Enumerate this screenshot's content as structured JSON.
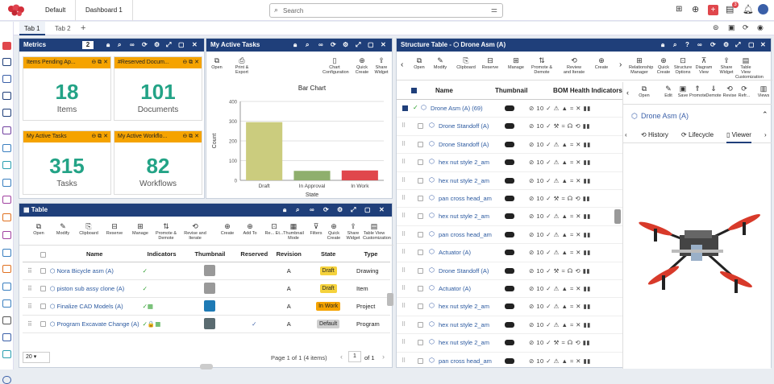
{
  "topbar": {
    "tab1": "Default",
    "tab2": "Dashboard 1",
    "search_placeholder": "Search",
    "notif_count": "3"
  },
  "tabbar": {
    "tab1": "Tab 1",
    "tab2": "Tab 2",
    "add": "+"
  },
  "metrics": {
    "title": "Metrics",
    "page": "2",
    "tiles": [
      {
        "header": "Items Pending Ap...",
        "value": "18",
        "label": "Items"
      },
      {
        "header": "#Reserved Docum...",
        "value": "101",
        "label": "Documents"
      },
      {
        "header": "My Active Tasks",
        "value": "315",
        "label": "Tasks"
      },
      {
        "header": "My Active Workflo...",
        "value": "82",
        "label": "Workflows"
      }
    ]
  },
  "tasks": {
    "title": "My Active Tasks",
    "toolbar": {
      "open": "Open",
      "print": "Print & Export",
      "chartcfg": "Chart Configuration",
      "quick": "Quick Create",
      "share": "Share Widget"
    }
  },
  "chart_data": {
    "type": "bar",
    "title": "Bar Chart",
    "xlabel": "State",
    "ylabel": "Count",
    "categories": [
      "Draft",
      "In Approval",
      "In Work"
    ],
    "values": [
      295,
      48,
      50
    ],
    "colors": [
      "#cbcc7e",
      "#8faf6d",
      "#e0474c"
    ],
    "ylim": [
      0,
      400
    ],
    "yticks": [
      "0",
      "100",
      "200",
      "300",
      "400"
    ],
    "grid": true
  },
  "table": {
    "title": "Table",
    "toolbar": [
      "Open",
      "Modify",
      "Clipboard",
      "Reserve",
      "Manage",
      "Promote & Demote",
      "Revise and Iterate",
      "Create",
      "Add To",
      "Re... Et...",
      "Thumbnail Mode",
      "Filters",
      "Quick Create",
      "Share Widget",
      "Table View Customization"
    ],
    "columns": [
      "Name",
      "Indicators",
      "Thumbnail",
      "Reserved",
      "Revision",
      "State",
      "Type"
    ],
    "rows": [
      {
        "name": "Nora Bicycle asm (A)",
        "indicator": "✓",
        "reserved": "",
        "revision": "A",
        "state": "Draft",
        "type": "Drawing"
      },
      {
        "name": "piston sub assy clone (A)",
        "indicator": "✓",
        "reserved": "",
        "revision": "A",
        "state": "Draft",
        "type": "Item"
      },
      {
        "name": "Finalize CAD Models (A)",
        "indicator": "✓▦",
        "reserved": "",
        "revision": "A",
        "state": "In Work",
        "type": "Project"
      },
      {
        "name": "Program Excavate Change (A)",
        "indicator": "✓🔒▦",
        "reserved": "✓",
        "revision": "A",
        "state": "Default",
        "type": "Program"
      }
    ],
    "page_size": "20",
    "pagination": "Page 1 of 1 (4 items)",
    "page_num": "1",
    "of": "of 1"
  },
  "structure": {
    "title": "Structure Table - ⬡ Drone Asm (A)",
    "toolbar": [
      "Open",
      "Modify",
      "Clipboard",
      "Reserve",
      "Manage",
      "Promote & Demote",
      "Review and Iterate",
      "Create",
      "Relationship Manager",
      "Quick Create",
      "Structure Options",
      "Diagram View",
      "Share Widget",
      "Table View Customization"
    ],
    "columns": [
      "Name",
      "Thumbnail",
      "BOM Health Indicators"
    ],
    "root": "Drone Asm (A) (69)",
    "rows": [
      "Drone Standoff (A)",
      "Drone Standoff (A)",
      "hex nut style 2_am",
      "hex nut style 2_am",
      "pan cross head_am",
      "hex nut style 2_am",
      "pan cross head_am",
      "Actuator (A)",
      "Drone Standoff (A)",
      "Actuator (A)",
      "hex nut style 2_am",
      "hex nut style 2_am",
      "hex nut style 2_am",
      "pan cross head_am"
    ],
    "health": "⊘ 10 ✓ ⚠ ▲ ≈ ✕ ▮▮",
    "health_alt": "⊘ 10 ✓ ⚒ ≈ ☊ ⟲ ▮▮"
  },
  "details": {
    "toolbar": [
      "Open",
      "Edit",
      "Save",
      "Promote",
      "Demote",
      "Revise",
      "Refr...",
      "Views"
    ],
    "item": "Drone Asm (A)",
    "tabs": [
      "History",
      "Lifecycle",
      "Viewer"
    ]
  }
}
